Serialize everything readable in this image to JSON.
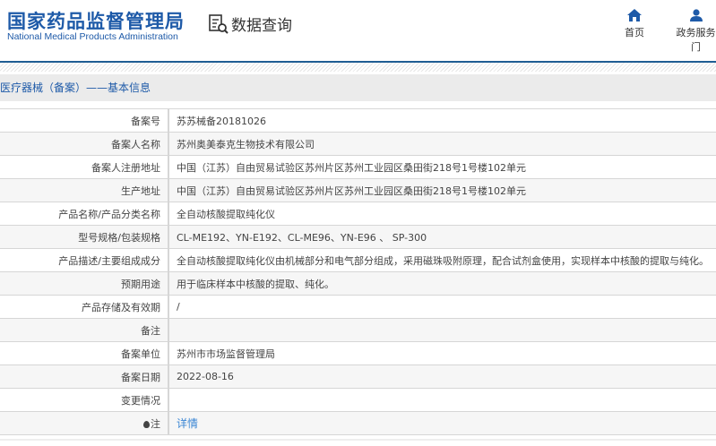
{
  "header": {
    "logo_cn": "国家药品监督管理局",
    "logo_en": "National Medical Products Administration",
    "query_title": "数据查询",
    "nav": [
      {
        "label": "首页",
        "icon": "home-icon"
      },
      {
        "label": "政务服务门",
        "icon": "user-icon"
      }
    ]
  },
  "breadcrumb": "医疗器械（备案）——基本信息",
  "colors": {
    "brand": "#1e5aa8",
    "link": "#3a86d4"
  },
  "rows": [
    {
      "label": "备案号",
      "value": "苏苏械备20181026"
    },
    {
      "label": "备案人名称",
      "value": "苏州奥美泰克生物技术有限公司"
    },
    {
      "label": "备案人注册地址",
      "value": "中国（江苏）自由贸易试验区苏州片区苏州工业园区桑田街218号1号楼102单元"
    },
    {
      "label": "生产地址",
      "value": "中国（江苏）自由贸易试验区苏州片区苏州工业园区桑田街218号1号楼102单元"
    },
    {
      "label": "产品名称/产品分类名称",
      "value": "全自动核酸提取纯化仪"
    },
    {
      "label": "型号规格/包装规格",
      "value": "CL-ME192、YN-E192、CL-ME96、YN-E96 、 SP-300"
    },
    {
      "label": "产品描述/主要组成成分",
      "value": "全自动核酸提取纯化仪由机械部分和电气部分组成，采用磁珠吸附原理，配合试剂盒使用，实现样本中核酸的提取与纯化。"
    },
    {
      "label": "预期用途",
      "value": "用于临床样本中核酸的提取、纯化。"
    },
    {
      "label": "产品存储及有效期",
      "value": "/"
    },
    {
      "label": "备注",
      "value": ""
    },
    {
      "label": "备案单位",
      "value": "苏州市市场监督管理局"
    },
    {
      "label": "备案日期",
      "value": "2022-08-16"
    },
    {
      "label": "变更情况",
      "value": ""
    },
    {
      "label": "注",
      "value": "详情"
    }
  ]
}
